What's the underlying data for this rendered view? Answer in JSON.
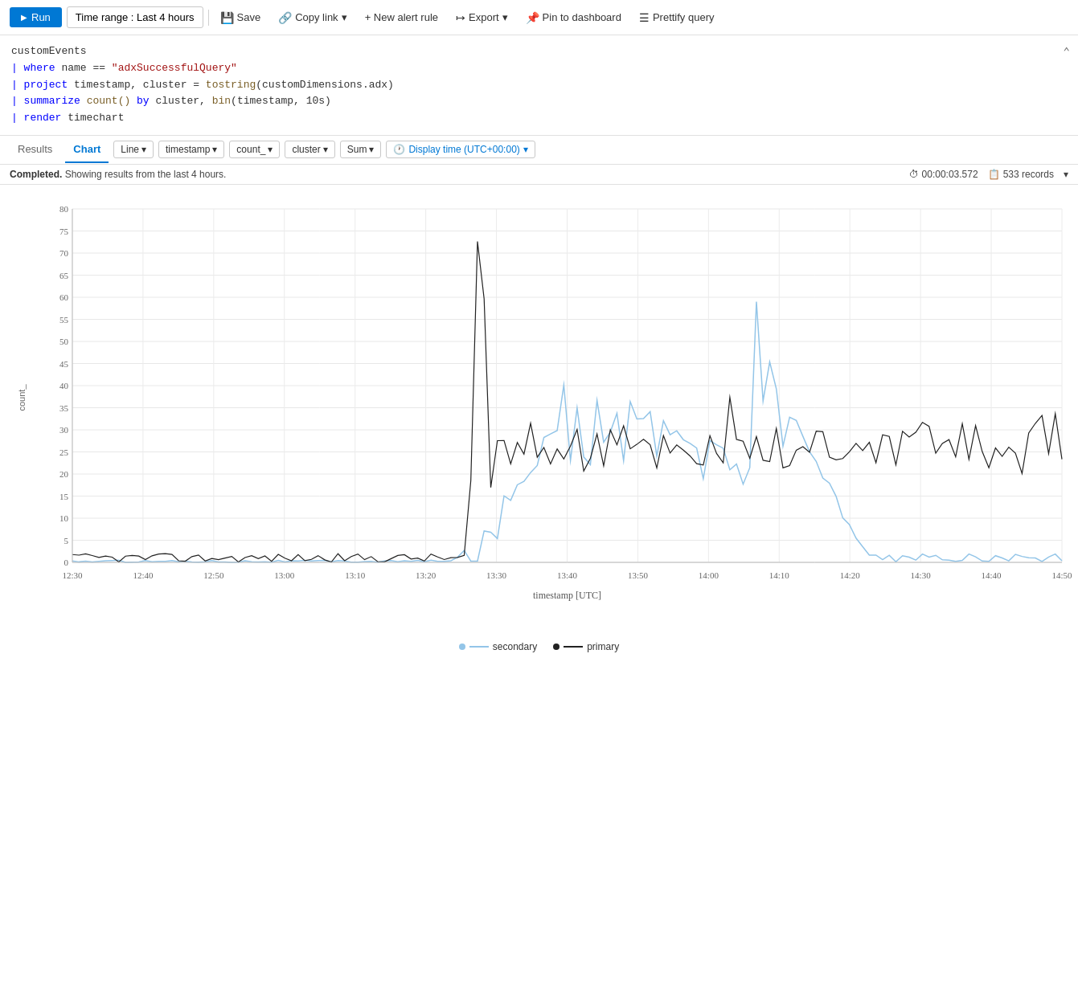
{
  "toolbar": {
    "run_label": "Run",
    "time_range_label": "Time range : Last 4 hours",
    "save_label": "Save",
    "copy_link_label": "Copy link",
    "new_alert_label": "+ New alert rule",
    "export_label": "Export",
    "pin_dashboard_label": "Pin to dashboard",
    "prettify_label": "Prettify query"
  },
  "query": {
    "line1": "customEvents",
    "line2": "| where name == \"adxSuccessfulQuery\"",
    "line3": "| project timestamp, cluster = tostring(customDimensions.adx)",
    "line4": "| summarize count() by cluster, bin(timestamp, 10s)",
    "line5": "| render timechart"
  },
  "tabs": {
    "results_label": "Results",
    "chart_label": "Chart"
  },
  "chart_options": {
    "line_label": "Line",
    "timestamp_label": "timestamp",
    "count_label": "count_",
    "cluster_label": "cluster",
    "sum_label": "Sum",
    "display_time_label": "Display time (UTC+00:00)"
  },
  "status": {
    "completed_label": "Completed.",
    "showing_label": "Showing results from the last 4 hours.",
    "timing": "00:00:03.572",
    "records": "533 records"
  },
  "chart": {
    "y_label": "count_",
    "x_label": "timestamp [UTC]",
    "y_ticks": [
      "0",
      "5",
      "10",
      "15",
      "20",
      "25",
      "30",
      "35",
      "40",
      "45",
      "50",
      "55",
      "60",
      "65",
      "70",
      "75",
      "80"
    ],
    "x_ticks": [
      "12:30",
      "12:40",
      "12:50",
      "13:00",
      "13:10",
      "13:20",
      "13:30",
      "13:40",
      "13:50",
      "14:00",
      "14:10",
      "14:20",
      "14:30",
      "14:40",
      "14:50"
    ]
  },
  "legend": {
    "secondary_label": "secondary",
    "primary_label": "primary"
  },
  "colors": {
    "run_btn": "#0078d4",
    "accent": "#0078d4",
    "primary_line": "#222222",
    "secondary_line": "#93c5e8"
  }
}
